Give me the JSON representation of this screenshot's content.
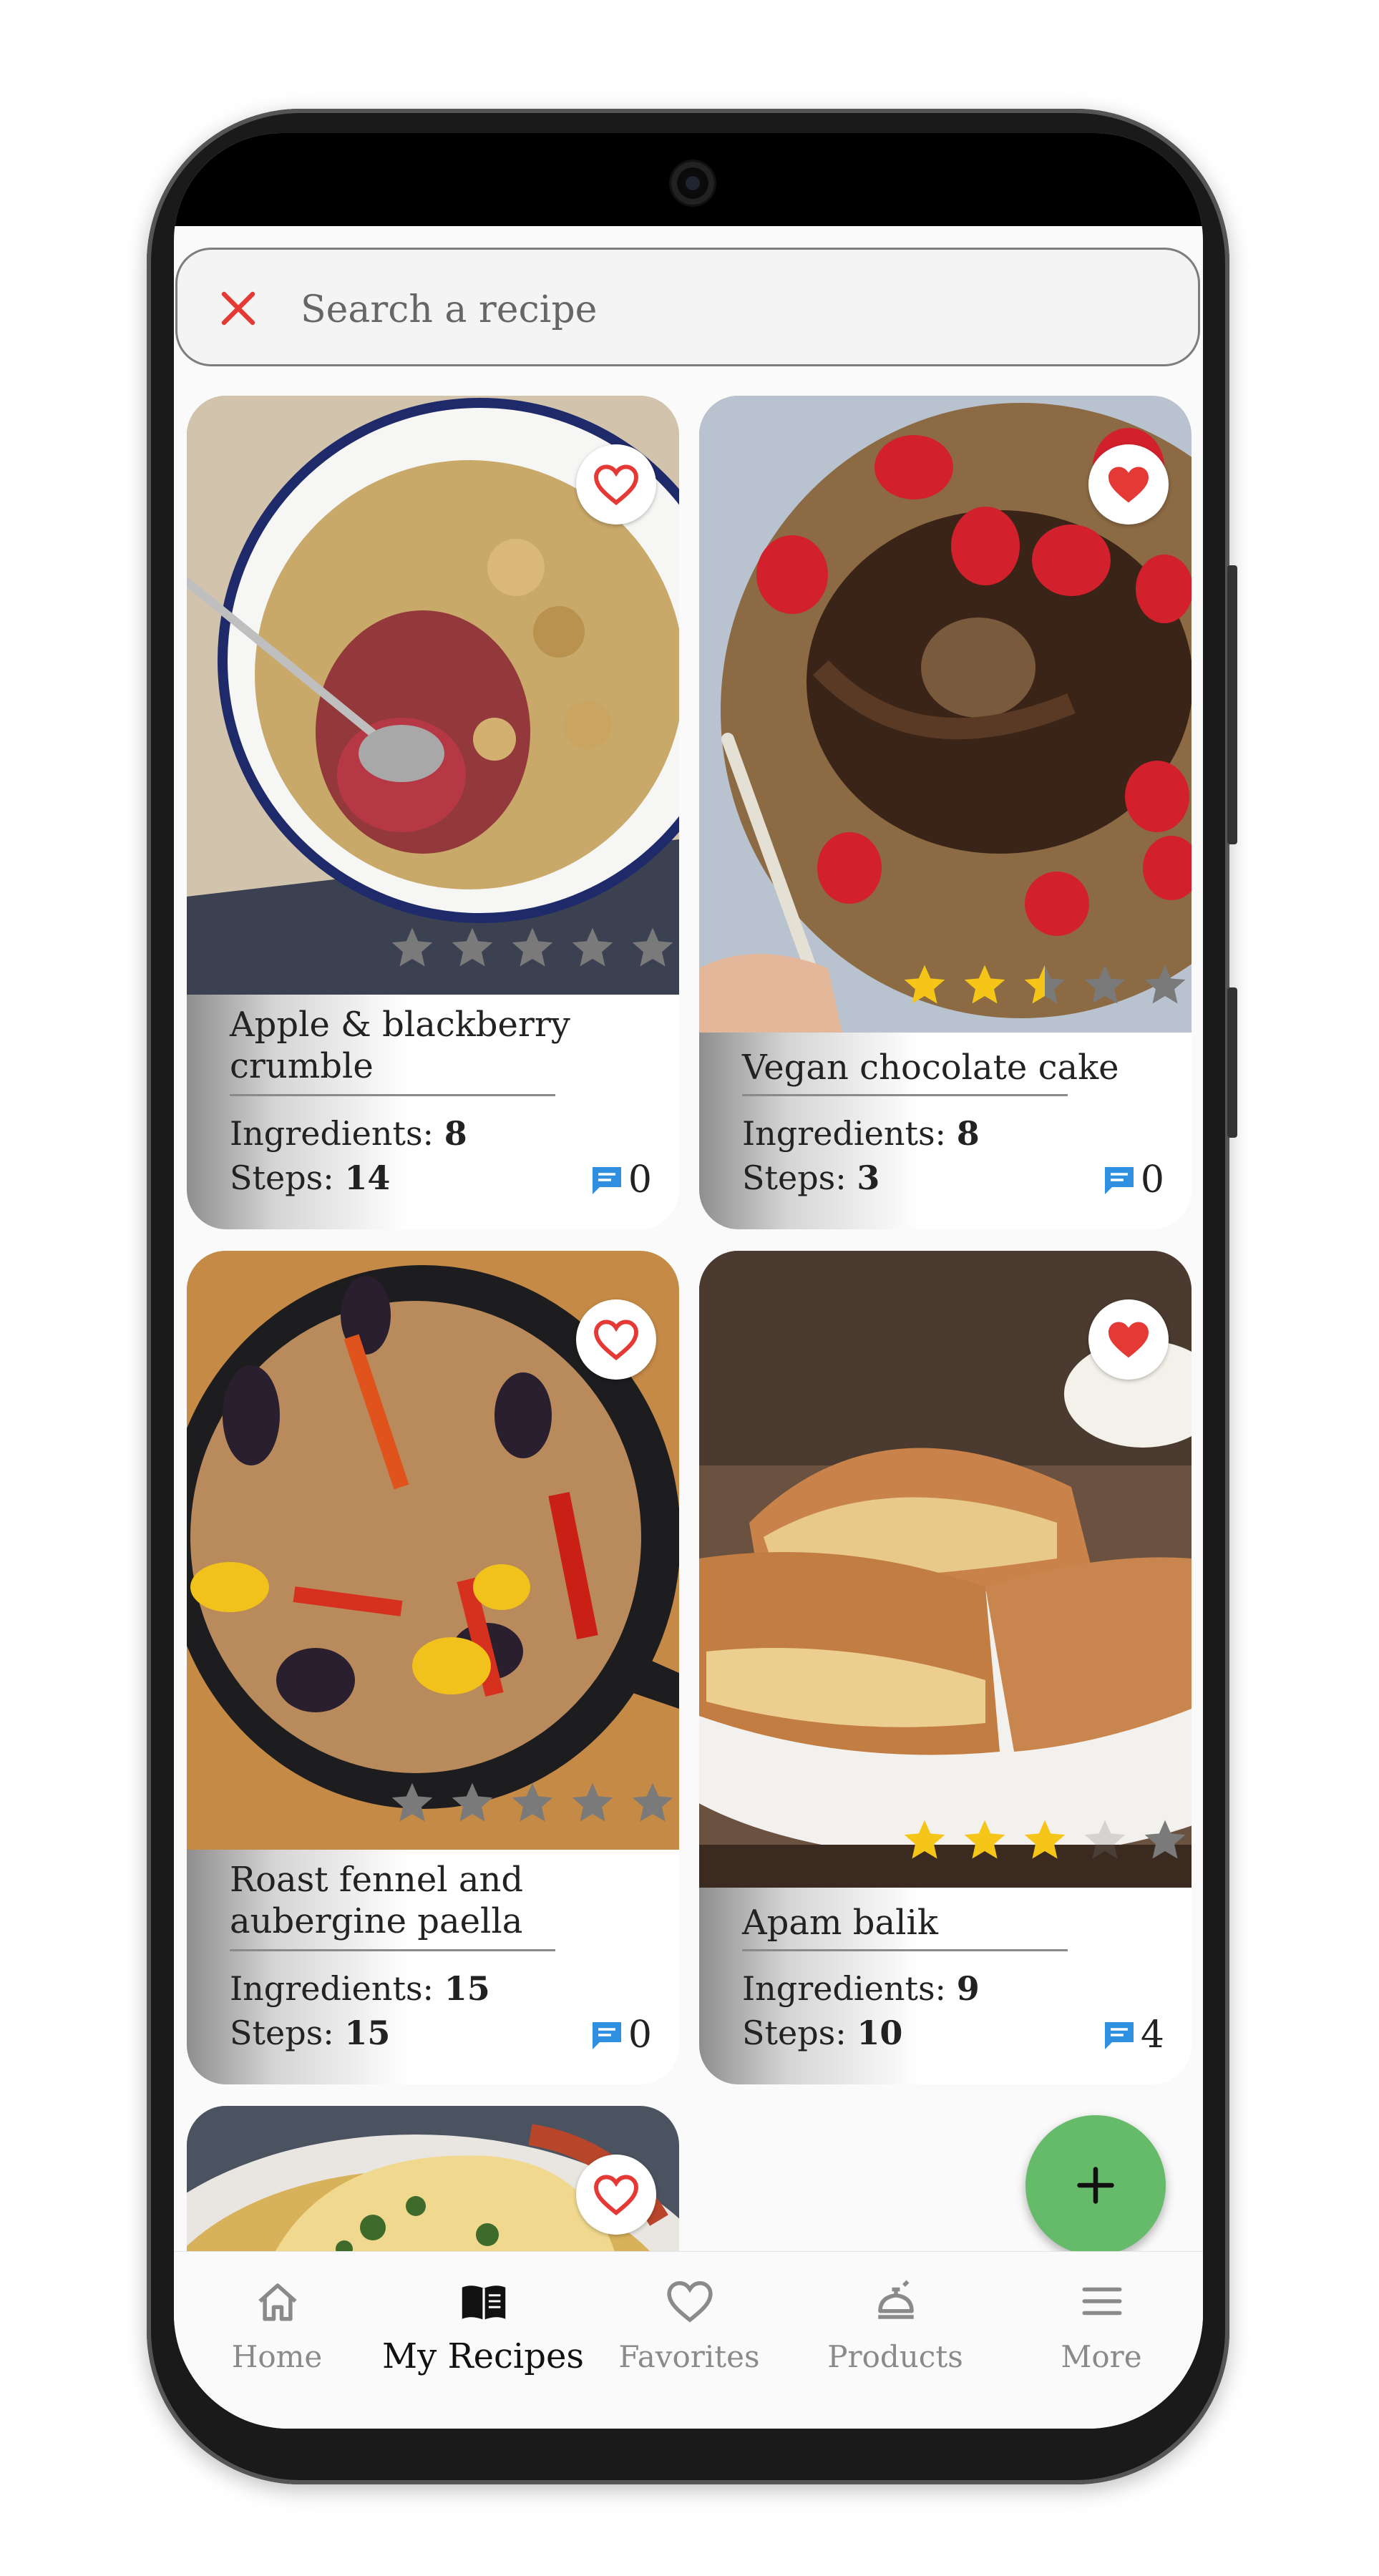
{
  "search": {
    "placeholder": "Search a recipe"
  },
  "recipes": [
    {
      "title": "Apple & blackberry crumble",
      "ingredients_label": "Ingredients:",
      "ingredients": "8",
      "steps_label": "Steps:",
      "steps": "14",
      "comments": "0",
      "favorite": false,
      "rating": 0
    },
    {
      "title": "Vegan chocolate cake",
      "ingredients_label": "Ingredients:",
      "ingredients": "8",
      "steps_label": "Steps:",
      "steps": "3",
      "comments": "0",
      "favorite": true,
      "rating": 2.5
    },
    {
      "title": "Roast fennel and aubergine paella",
      "ingredients_label": "Ingredients:",
      "ingredients": "15",
      "steps_label": "Steps:",
      "steps": "15",
      "comments": "0",
      "favorite": false,
      "rating": 0
    },
    {
      "title": "Apam balik",
      "ingredients_label": "Ingredients:",
      "ingredients": "9",
      "steps_label": "Steps:",
      "steps": "10",
      "comments": "4",
      "favorite": true,
      "rating": 3
    },
    {
      "title": "",
      "favorite": false
    }
  ],
  "nav": {
    "items": [
      {
        "label": "Home",
        "icon": "home-icon"
      },
      {
        "label": "My Recipes",
        "icon": "book-icon"
      },
      {
        "label": "Favorites",
        "icon": "heart-icon"
      },
      {
        "label": "Products",
        "icon": "products-icon"
      },
      {
        "label": "More",
        "icon": "menu-icon"
      }
    ],
    "active": "My Recipes"
  },
  "colors": {
    "accent_red": "#e53935",
    "star_gold": "#f5c518",
    "fab_green": "#66bb6a",
    "comment_blue": "#2f8fe0"
  }
}
